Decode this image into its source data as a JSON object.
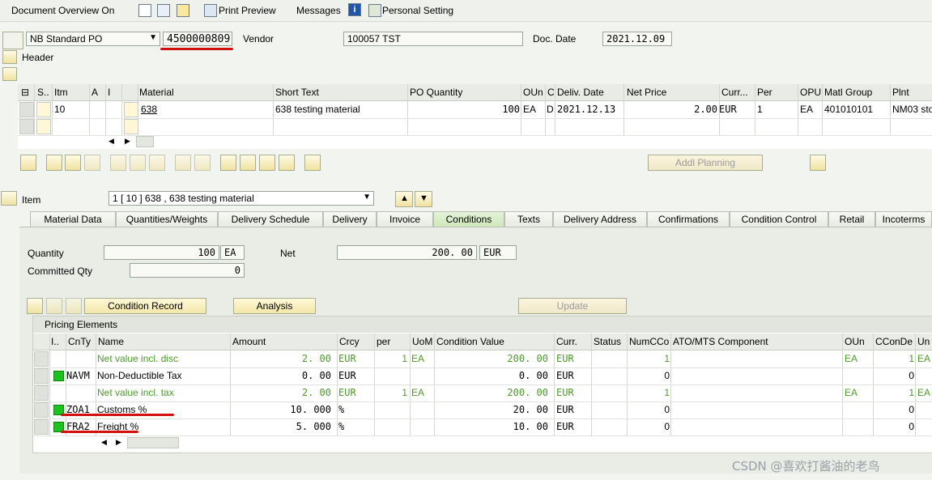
{
  "toolbar": {
    "title": "Document Overview On",
    "print_preview": "Print Preview",
    "messages": "Messages",
    "personal_setting": "Personal Setting"
  },
  "header": {
    "doc_type": "NB Standard PO",
    "po_number": "4500000809",
    "vendor_label": "Vendor",
    "vendor_value": "100057 TST",
    "doc_date_label": "Doc. Date",
    "doc_date_value": "2021.12.09",
    "header_label": "Header"
  },
  "items_table": {
    "columns": [
      "S..",
      "Itm",
      "A",
      "I",
      "Material",
      "Short Text",
      "PO Quantity",
      "OUn",
      "C",
      "Deliv. Date",
      "Net Price",
      "Curr...",
      "Per",
      "OPU",
      "Matl Group",
      "Plnt"
    ],
    "row": {
      "itm": "10",
      "material": "638",
      "short_text": "638 testing material",
      "po_quantity": "100",
      "oun": "EA",
      "c": "D",
      "deliv_date": "2021.12.13",
      "net_price": "2.00",
      "curr": "EUR",
      "per": "1",
      "opu": "EA",
      "matl_group": "401010101",
      "plnt": "NM03 sto"
    }
  },
  "addl_planning": "Addl Planning",
  "item_section": {
    "label": "Item",
    "selected": "1 [ 10 ] 638 , 638 testing material"
  },
  "tabs": [
    "Material Data",
    "Quantities/Weights",
    "Delivery Schedule",
    "Delivery",
    "Invoice",
    "Conditions",
    "Texts",
    "Delivery Address",
    "Confirmations",
    "Condition Control",
    "Retail",
    "Incoterms"
  ],
  "active_tab": "Conditions",
  "conditions": {
    "quantity_label": "Quantity",
    "quantity_value": "100",
    "quantity_unit": "EA",
    "net_label": "Net",
    "net_value": "200. 00",
    "net_currency": "EUR",
    "committed_label": "Committed Qty",
    "committed_value": "0",
    "condition_record_btn": "Condition Record",
    "analysis_btn": "Analysis",
    "update_btn": "Update"
  },
  "pricing": {
    "title": "Pricing Elements",
    "columns": [
      "I..",
      "CnTy",
      "Name",
      "Amount",
      "Crcy",
      "per",
      "UoM",
      "Condition Value",
      "Curr.",
      "Status",
      "NumCCo",
      "ATO/MTS Component",
      "OUn",
      "CConDe",
      "Un"
    ],
    "rows": [
      {
        "cnty": "",
        "name": "Net value incl. disc",
        "amount": "2. 00",
        "crcy": "EUR",
        "per": "1",
        "uom": "EA",
        "value": "200. 00",
        "curr": "EUR",
        "numcco": "1",
        "oun": "EA",
        "ccon": "1",
        "un": "EA"
      },
      {
        "cnty": "NAVM",
        "name": "Non-Deductible Tax",
        "amount": "0. 00",
        "crcy": "EUR",
        "per": "",
        "uom": "",
        "value": "0. 00",
        "curr": "EUR",
        "numcco": "0",
        "oun": "",
        "ccon": "0",
        "un": ""
      },
      {
        "cnty": "",
        "name": "Net value incl. tax",
        "amount": "2. 00",
        "crcy": "EUR",
        "per": "1",
        "uom": "EA",
        "value": "200. 00",
        "curr": "EUR",
        "numcco": "1",
        "oun": "EA",
        "ccon": "1",
        "un": "EA"
      },
      {
        "cnty": "ZOA1",
        "name": "Customs %",
        "amount": "10. 000",
        "crcy": "%",
        "per": "",
        "uom": "",
        "value": "20. 00",
        "curr": "EUR",
        "numcco": "0",
        "oun": "",
        "ccon": "0",
        "un": ""
      },
      {
        "cnty": "FRA2",
        "name": "Freight %",
        "amount": "5. 000",
        "crcy": "%",
        "per": "",
        "uom": "",
        "value": "10. 00",
        "curr": "EUR",
        "numcco": "0",
        "oun": "",
        "ccon": "0",
        "un": ""
      }
    ]
  },
  "watermark": "CSDN @喜欢打酱油的老鸟",
  "colors": {
    "green_text": "#4d9a2a",
    "status_green": "#1ec21e",
    "highlight_red": "#d31010",
    "active_tab": "#cfe7bb"
  }
}
